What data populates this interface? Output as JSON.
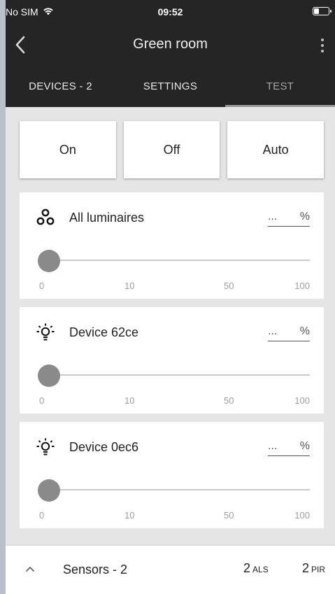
{
  "status_bar": {
    "carrier": "No SIM",
    "time": "09:52"
  },
  "header": {
    "title": "Green room",
    "back_icon": "chevron-left-icon",
    "menu_icon": "more-vertical-icon"
  },
  "tabs": [
    {
      "label": "DEVICES - 2",
      "active": false
    },
    {
      "label": "SETTINGS",
      "active": false
    },
    {
      "label": "TEST",
      "active": true
    }
  ],
  "modes": {
    "on": "On",
    "off": "Off",
    "auto": "Auto"
  },
  "cards": [
    {
      "name": "All luminaires",
      "icon": "group-icon",
      "value": "...",
      "unit": "%",
      "slider_level": 0,
      "ticks": [
        "0",
        "10",
        "50",
        "100"
      ]
    },
    {
      "name": "Device 62ce",
      "icon": "lightbulb-icon",
      "value": "...",
      "unit": "%",
      "slider_level": 0,
      "ticks": [
        "0",
        "10",
        "50",
        "100"
      ]
    },
    {
      "name": "Device 0ec6",
      "icon": "lightbulb-icon",
      "value": "...",
      "unit": "%",
      "slider_level": 0,
      "ticks": [
        "0",
        "10",
        "50",
        "100"
      ]
    }
  ],
  "sensors": {
    "label": "Sensors - 2",
    "als_count": "2",
    "als_label": "ALS",
    "pir_count": "2",
    "pir_label": "PIR"
  }
}
